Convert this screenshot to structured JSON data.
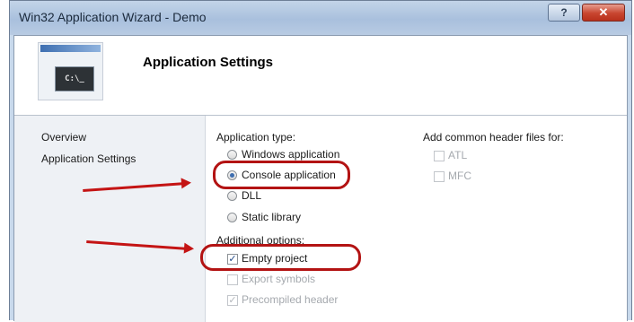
{
  "window": {
    "title": "Win32 Application Wizard - Demo",
    "help_label": "?",
    "close_label": "✕"
  },
  "banner": {
    "title": "Application Settings",
    "console_glyph": "C:\\_"
  },
  "nav": {
    "items": [
      {
        "label": "Overview"
      },
      {
        "label": "Application Settings"
      }
    ]
  },
  "application_type": {
    "heading": "Application type:",
    "options": [
      {
        "label": "Windows application",
        "selected": false
      },
      {
        "label": "Console application",
        "selected": true
      },
      {
        "label": "DLL",
        "selected": false
      },
      {
        "label": "Static library",
        "selected": false
      }
    ]
  },
  "additional_options": {
    "heading": "Additional options:",
    "options": [
      {
        "label": "Empty project",
        "checked": true,
        "enabled": true
      },
      {
        "label": "Export symbols",
        "checked": false,
        "enabled": false
      },
      {
        "label": "Precompiled header",
        "checked": true,
        "enabled": false
      }
    ]
  },
  "common_headers": {
    "heading": "Add common header files for:",
    "options": [
      {
        "label": "ATL",
        "checked": false,
        "enabled": false
      },
      {
        "label": "MFC",
        "checked": false,
        "enabled": false
      }
    ]
  },
  "checkmark": "✓",
  "colors": {
    "annotation_red": "#c41414",
    "selection_blue": "#3f6fb0"
  }
}
